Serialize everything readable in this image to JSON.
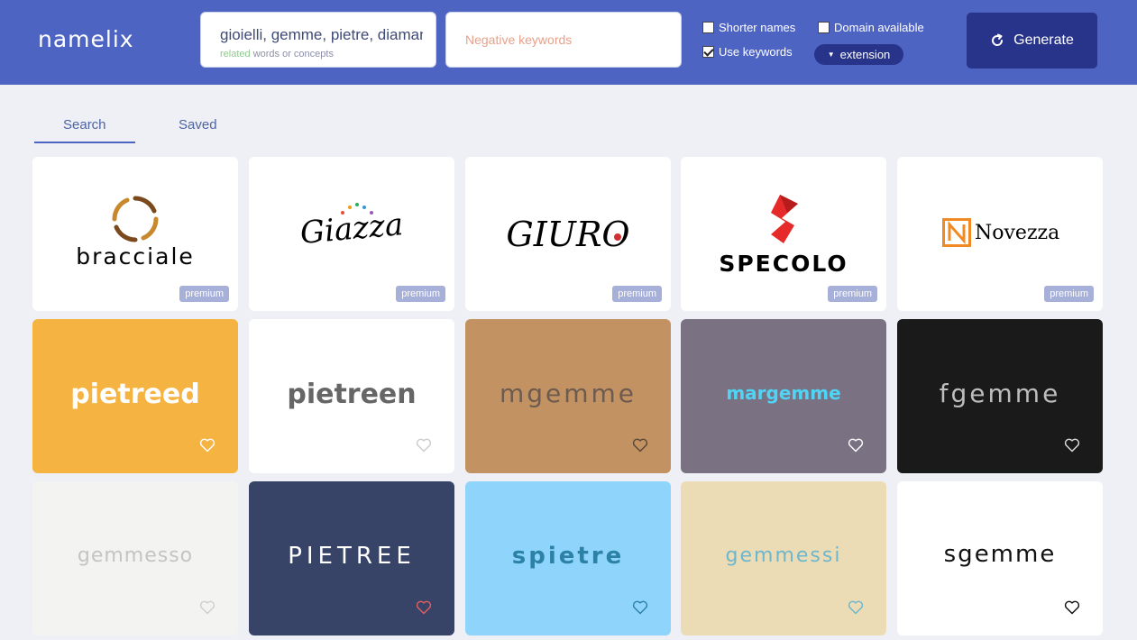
{
  "app": {
    "logo": "namelix"
  },
  "search": {
    "keywords_value": "gioielli, gemme, pietre, diamanti",
    "keywords_hint_highlight": "related",
    "keywords_hint_rest": " words or concepts",
    "negative_placeholder": "Negative keywords"
  },
  "options": {
    "shorter_names": "Shorter names",
    "use_keywords": "Use keywords",
    "domain_available": "Domain available",
    "extension": "extension",
    "generate": "Generate",
    "shorter_checked": false,
    "keywords_checked": true,
    "domain_checked": false
  },
  "tabs": [
    {
      "label": "Search",
      "active": true
    },
    {
      "label": "Saved",
      "active": false
    }
  ],
  "cards": [
    {
      "name": "bracciale",
      "premium": true,
      "bg": "#ffffff",
      "color": "#333333"
    },
    {
      "name": "Giazza",
      "premium": true,
      "bg": "#ffffff",
      "color": "#444444"
    },
    {
      "name": "GIURO",
      "premium": true,
      "bg": "#ffffff",
      "color": "#444444"
    },
    {
      "name": "SPECOLO",
      "premium": true,
      "bg": "#ffffff",
      "color": "#3a3a3a"
    },
    {
      "name": "Novezza",
      "premium": true,
      "bg": "#ffffff",
      "color": "#222222"
    },
    {
      "name": "pietreed",
      "premium": false,
      "bg": "#f5b342",
      "color": "#ffffff"
    },
    {
      "name": "pietreen",
      "premium": false,
      "bg": "#ffffff",
      "color": "#666666"
    },
    {
      "name": "mgemme",
      "premium": false,
      "bg": "#c29263",
      "color": "#6e5b4f"
    },
    {
      "name": "margemme",
      "premium": false,
      "bg": "#7a7282",
      "color": "#4fd4f5"
    },
    {
      "name": "fgemme",
      "premium": false,
      "bg": "#1a1a1a",
      "color": "#bdbdbd"
    },
    {
      "name": "gemmesso",
      "premium": false,
      "bg": "#f3f3f1",
      "color": "#c4c4c4"
    },
    {
      "name": "PIETREE",
      "premium": false,
      "bg": "#384368",
      "color": "#ffffff"
    },
    {
      "name": "spietre",
      "premium": false,
      "bg": "#8fd4fb",
      "color": "#2c82a6"
    },
    {
      "name": "gemmessi",
      "premium": false,
      "bg": "#ecdcb5",
      "color": "#6cb7cf"
    },
    {
      "name": "sgemme",
      "premium": false,
      "bg": "#ffffff",
      "color": "#111111"
    }
  ],
  "labels": {
    "premium": "premium"
  },
  "colors": {
    "header": "#4e64c3",
    "accent": "#27348a",
    "heart_active": "#e06060"
  }
}
